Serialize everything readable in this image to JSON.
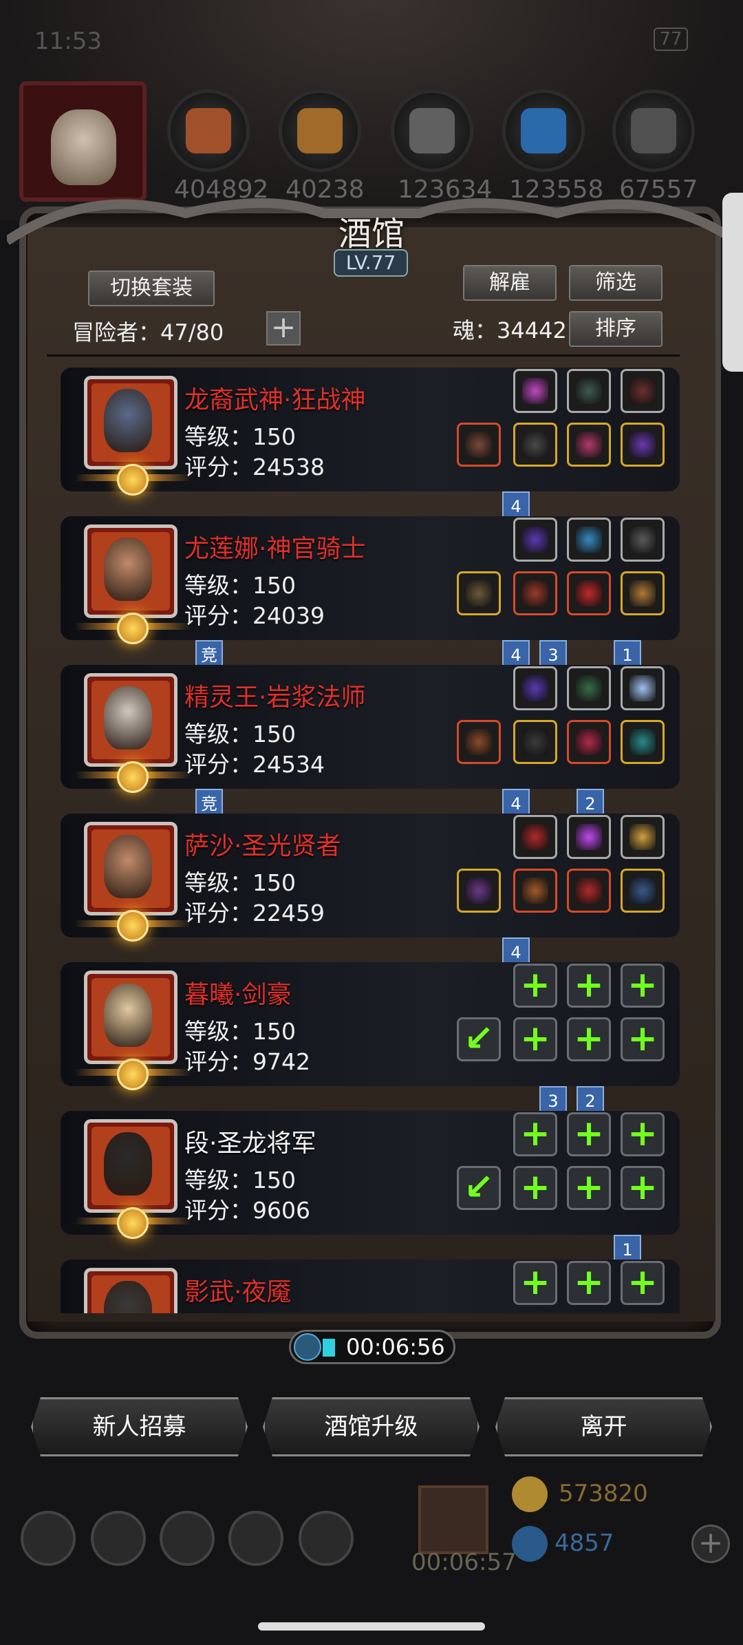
{
  "status_bar": {
    "time": "11:53",
    "battery": "77"
  },
  "resources": [
    {
      "value": "404892",
      "color": "#a0502a"
    },
    {
      "value": "40238",
      "color": "#a06a2a"
    },
    {
      "value": "123634",
      "color": "#606060"
    },
    {
      "value": "123558",
      "color": "#2a6aaa"
    },
    {
      "value": "67557",
      "color": "#505050"
    }
  ],
  "panel": {
    "title": "酒馆",
    "level": "LV.77",
    "switch_outfit": "切换套装",
    "dismiss": "解雇",
    "filter": "筛选",
    "sort": "排序",
    "adventurers_label": "冒险者：47/80",
    "soul_label": "魂：34442"
  },
  "heroes": [
    {
      "name": "龙裔武神·狂战神",
      "level": "等级：150",
      "score": "评分：24538",
      "name_color": "red",
      "portrait": "#5a6a8a",
      "top_slots": [
        {
          "c": "#c04ac0",
          "b": "silver"
        },
        {
          "c": "#405a50",
          "b": "silver"
        },
        {
          "c": "#6a3030",
          "b": "silver"
        }
      ],
      "bottom_slots": [
        {
          "c": "#7a4a3a",
          "b": "red"
        },
        {
          "c": "#4a4a4a",
          "b": "gold"
        },
        {
          "c": "#b03a6a",
          "b": "gold"
        },
        {
          "c": "#6a3ab0",
          "b": "gold"
        }
      ],
      "badges_below": [
        {
          "text": "4",
          "col": 1
        }
      ],
      "arena": false
    },
    {
      "name": "尤莲娜·神官骑士",
      "level": "等级：150",
      "score": "评分：24039",
      "name_color": "red",
      "portrait": "#c08a6a",
      "top_slots": [
        {
          "c": "#5a3ab0",
          "b": "silver"
        },
        {
          "c": "#3a8ac0",
          "b": "silver"
        },
        {
          "c": "#5a5a5a",
          "b": "silver"
        }
      ],
      "bottom_slots": [
        {
          "c": "#6a5a3a",
          "b": "gold"
        },
        {
          "c": "#9a3a2a",
          "b": "red"
        },
        {
          "c": "#c02a2a",
          "b": "red"
        },
        {
          "c": "#b07a3a",
          "b": "gold"
        }
      ],
      "badges_below": [
        {
          "text": "4",
          "col": 1
        },
        {
          "text": "3",
          "col": 2
        },
        {
          "text": "1",
          "col": 4
        }
      ],
      "arena": true,
      "arena_label": "竞"
    },
    {
      "name": "精灵王·岩浆法师",
      "level": "等级：150",
      "score": "评分：24534",
      "name_color": "red",
      "portrait": "#d0c8c0",
      "top_slots": [
        {
          "c": "#5a3ab0",
          "b": "silver"
        },
        {
          "c": "#3a6a4a",
          "b": "silver"
        },
        {
          "c": "#a0c0f0",
          "b": "silver"
        }
      ],
      "bottom_slots": [
        {
          "c": "#8a4a2a",
          "b": "red"
        },
        {
          "c": "#3a3a3a",
          "b": "gold"
        },
        {
          "c": "#b02a4a",
          "b": "red"
        },
        {
          "c": "#2a8a8a",
          "b": "gold"
        }
      ],
      "badges_below": [
        {
          "text": "4",
          "col": 1
        },
        {
          "text": "2",
          "col": 3
        }
      ],
      "arena": true,
      "arena_label": "竞"
    },
    {
      "name": "萨沙·圣光贤者",
      "level": "等级：150",
      "score": "评分：22459",
      "name_color": "red",
      "portrait": "#c08a6a",
      "top_slots": [
        {
          "c": "#b02a2a",
          "b": "silver"
        },
        {
          "c": "#c04af0",
          "b": "silver"
        },
        {
          "c": "#d0a040",
          "b": "silver"
        }
      ],
      "bottom_slots": [
        {
          "c": "#6a3a8a",
          "b": "gold"
        },
        {
          "c": "#a05a2a",
          "b": "red"
        },
        {
          "c": "#b02a2a",
          "b": "red"
        },
        {
          "c": "#3a5a8a",
          "b": "gold"
        }
      ],
      "badges_below": [
        {
          "text": "4",
          "col": 1
        }
      ],
      "arena": false
    },
    {
      "name": "暮曦·剑豪",
      "level": "等级：150",
      "score": "评分：9742",
      "name_color": "red",
      "portrait": "#e0c8a0",
      "top_slots": "add",
      "bottom_slots": "add",
      "badges_below": [
        {
          "text": "3",
          "col": 2
        },
        {
          "text": "2",
          "col": 3
        }
      ],
      "arena": false
    },
    {
      "name": "段·圣龙将军",
      "level": "等级：150",
      "score": "评分：9606",
      "name_color": "white",
      "portrait": "#2a2a2a",
      "top_slots": "add",
      "bottom_slots": "add",
      "badges_below": [
        {
          "text": "1",
          "col": 4
        }
      ],
      "arena": false
    },
    {
      "name": "影武·夜魇",
      "level": "",
      "score": "",
      "name_color": "red",
      "portrait": "#3a3a3a",
      "top_slots": "add",
      "bottom_slots": "none",
      "badges_below": [],
      "arena": false
    }
  ],
  "timer": "00:06:56",
  "bottom_buttons": {
    "recruit": "新人招募",
    "upgrade": "酒馆升级",
    "leave": "离开"
  },
  "footer": {
    "timer": "00:06:57",
    "gold": "573820",
    "gems": "4857"
  }
}
